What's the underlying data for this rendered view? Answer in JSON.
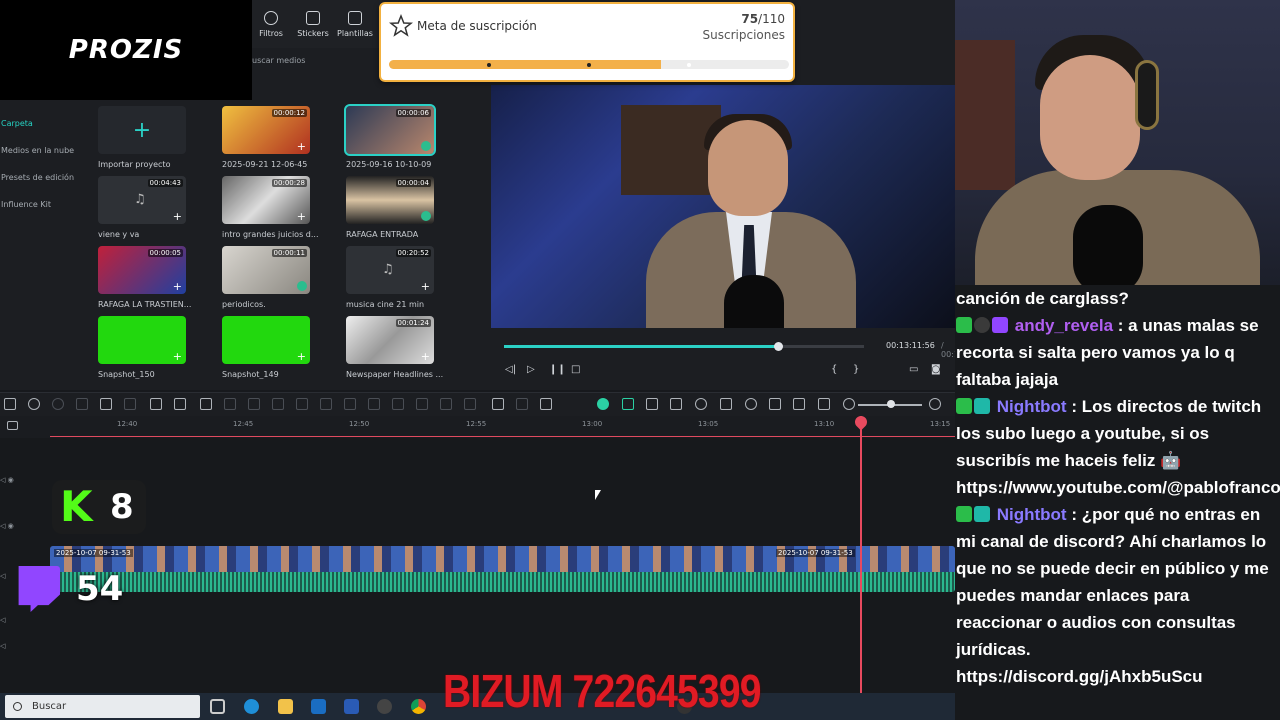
{
  "sponsor": {
    "brand": "PROZIS"
  },
  "editor": {
    "tabs": [
      {
        "label": "Filtros",
        "icon": "filter-icon"
      },
      {
        "label": "Stickers",
        "icon": "sticker-icon"
      },
      {
        "label": "Plantillas",
        "icon": "template-icon"
      }
    ],
    "search_placeholder": "uscar medios",
    "folders": [
      {
        "label": "Carpeta",
        "active": true
      },
      {
        "label": "Medios en la nube"
      },
      {
        "label": "Presets de edición"
      },
      {
        "label": "Influence Kit"
      }
    ],
    "media": [
      {
        "label": "Importar proyecto",
        "duration": "",
        "kind": "import"
      },
      {
        "label": "2025-09-21 12-06-45",
        "duration": "00:00:12"
      },
      {
        "label": "2025-09-16 10-10-09",
        "duration": "00:00:06",
        "selected": true
      },
      {
        "label": "viene y va",
        "duration": "00:04:43",
        "kind": "audio"
      },
      {
        "label": "intro grandes juicios d...",
        "duration": "00:00:28"
      },
      {
        "label": "RAFAGA ENTRADA",
        "duration": "00:00:04"
      },
      {
        "label": "RAFAGA LA TRASTIEN...",
        "duration": "00:00:05"
      },
      {
        "label": "periodicos.",
        "duration": "00:00:11"
      },
      {
        "label": "musica cine 21 min",
        "duration": "00:20:52",
        "kind": "audio"
      },
      {
        "label": "Snapshot_150",
        "duration": "",
        "kind": "green"
      },
      {
        "label": "Snapshot_149",
        "duration": "",
        "kind": "green"
      },
      {
        "label": "Newspaper Headlines ...",
        "duration": "00:01:24"
      }
    ],
    "player": {
      "timecode": "00:13:11:56",
      "total": "/ 00:17:04:4",
      "progress": 0.76
    },
    "timeline": {
      "ticks": [
        "12:40",
        "12:45",
        "12:50",
        "12:55",
        "13:00",
        "13:05",
        "13:10",
        "13:15"
      ],
      "clip_labels": [
        "2025-10-07 09-31-53",
        "2025-10-07 09-31-53"
      ]
    }
  },
  "goal": {
    "title": "Meta de suscripción",
    "current": "75",
    "target": "/110",
    "unit": "Suscripciones",
    "progress": 0.68
  },
  "badges": {
    "kick_count": "8",
    "twitch_count": "54"
  },
  "bizum": "BIZUM 722645399",
  "taskbar": {
    "search": "Buscar"
  },
  "chat": [
    {
      "user": "",
      "text": "canción de carglass?"
    },
    {
      "user": "andy_revela",
      "text": ": a unas malas se recorta si salta pero vamos ya lo q faltaba jajaja",
      "badges": [
        "green",
        "dark",
        "purple"
      ]
    },
    {
      "user": "Nightbot",
      "text": ": Los directos de twitch los subo luego a youtube, si os suscribís me haceis feliz 🤖 https://www.youtube.com/@pablofrancoabogado",
      "badges": [
        "green",
        "teal"
      ],
      "bot": true
    },
    {
      "user": "Nightbot",
      "text": ": ¿por qué no entras en mi canal de discord? Ahí charlamos lo que no se puede decir en público y me puedes mandar enlaces para reaccionar o audios con consultas jurídicas. https://discord.gg/jAhxb5uScu",
      "badges": [
        "green",
        "teal"
      ],
      "bot": true
    }
  ],
  "colors": {
    "accent": "#2bd1c6",
    "goal": "#f3b04a",
    "bizum": "#e01b24",
    "kick": "#53fc18",
    "twitch": "#9146ff"
  }
}
